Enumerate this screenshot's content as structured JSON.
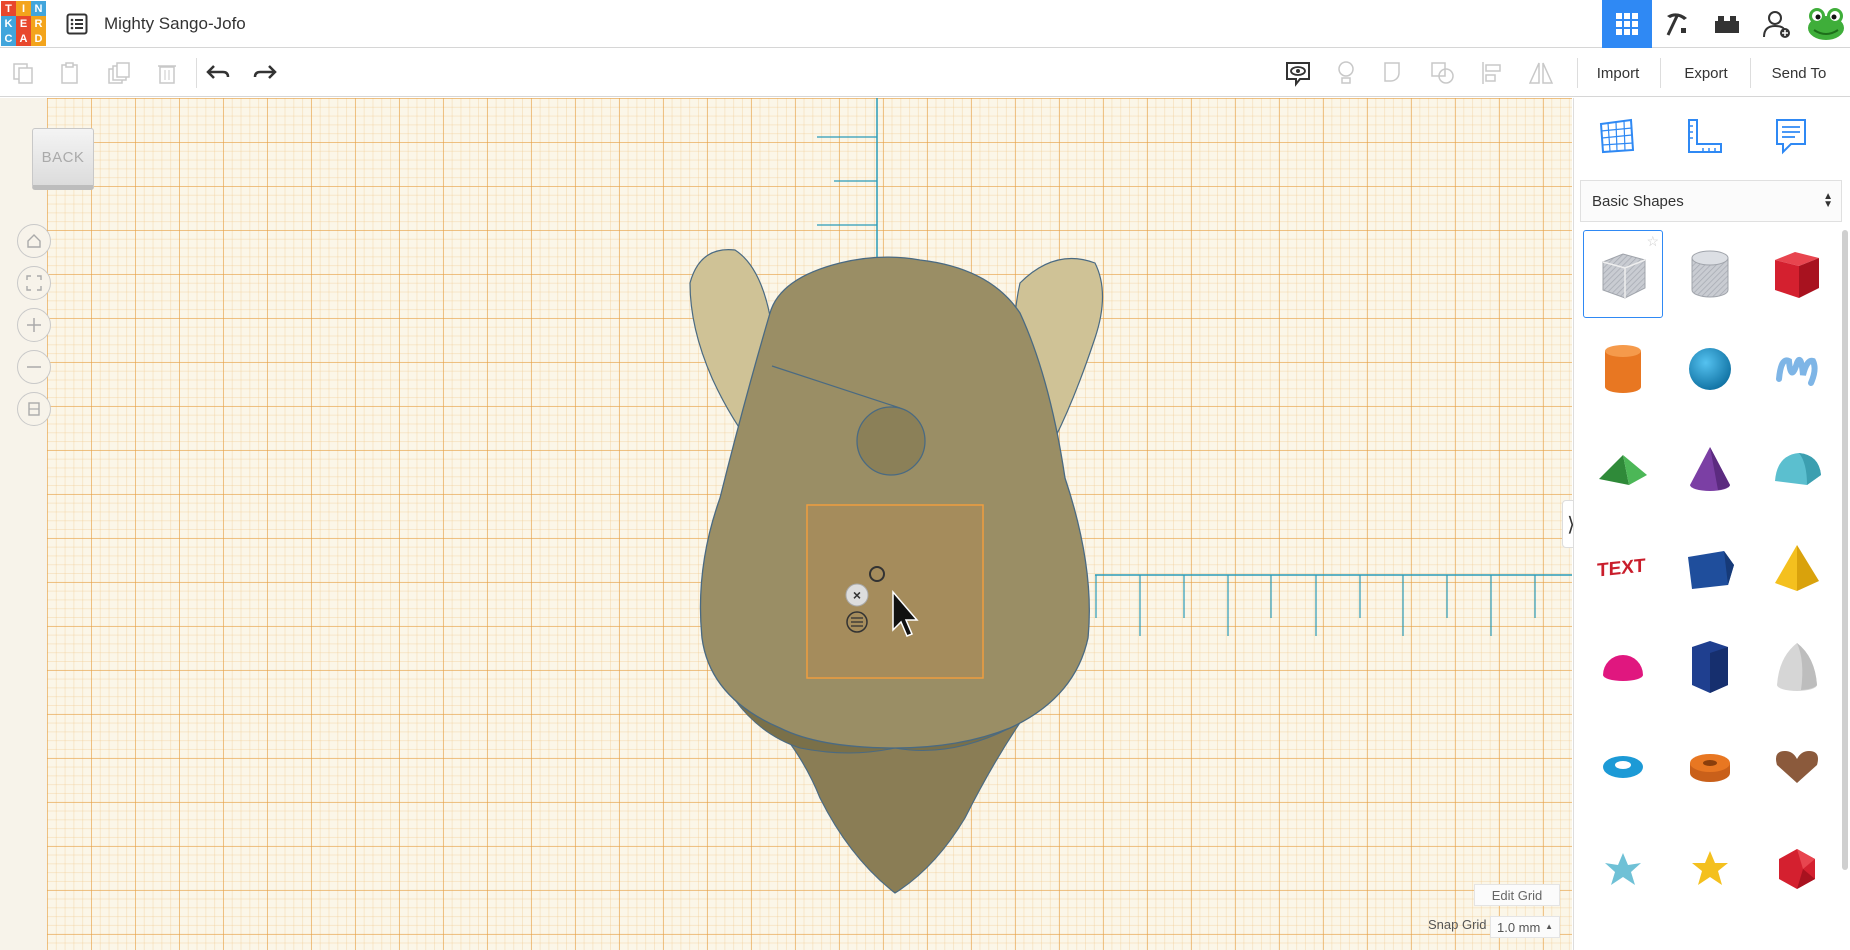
{
  "app": {
    "logo_letters": [
      "T",
      "I",
      "N",
      "K",
      "E",
      "R",
      "C",
      "A",
      "D"
    ],
    "logo_colors": [
      "#e8472c",
      "#f3a41c",
      "#41a5dc",
      "#41a5dc",
      "#e8472c",
      "#f3a41c",
      "#41a5dc",
      "#e8472c",
      "#f3a41c"
    ],
    "title": "Mighty Sango-Jofo"
  },
  "header": {
    "buttons": [
      {
        "name": "grid-view",
        "icon": "grid-icon",
        "active": true
      },
      {
        "name": "build",
        "icon": "pickaxe-icon"
      },
      {
        "name": "bricks",
        "icon": "brick-icon"
      },
      {
        "name": "add-user",
        "icon": "user-add-icon"
      },
      {
        "name": "profile",
        "icon": "avatar-icon"
      }
    ]
  },
  "toolbar": {
    "tools": [
      "copy-icon",
      "paste-icon",
      "duplicate-icon",
      "delete-icon",
      "undo-icon",
      "redo-icon"
    ],
    "view_tools": [
      "notes-visibility-icon",
      "light-icon",
      "group-icon",
      "ungroup-icon",
      "align-icon",
      "mirror-icon"
    ],
    "import_label": "Import",
    "export_label": "Export",
    "send_to_label": "Send To"
  },
  "canvas": {
    "back_label": "BACK",
    "nav": [
      "home-icon",
      "fit-icon",
      "zoom-in-icon",
      "zoom-out-icon",
      "perspective-icon"
    ],
    "edit_grid_label": "Edit Grid",
    "snap_grid_label": "Snap Grid",
    "snap_grid_value": "1.0 mm"
  },
  "sidebar": {
    "top_icons": [
      "workplane-icon",
      "ruler-icon",
      "notes-icon"
    ],
    "category": "Basic Shapes",
    "shapes": [
      {
        "name": "box-hole",
        "color": "#b8bcc4"
      },
      {
        "name": "cylinder-hole",
        "color": "#c4c8cf"
      },
      {
        "name": "box",
        "color": "#d4202f"
      },
      {
        "name": "cylinder",
        "color": "#e87722"
      },
      {
        "name": "sphere",
        "color": "#1c9ad6"
      },
      {
        "name": "scribble",
        "color": "#7eb5e6"
      },
      {
        "name": "roof",
        "color": "#3aa346"
      },
      {
        "name": "cone",
        "color": "#7b3fa4"
      },
      {
        "name": "round-roof",
        "color": "#5bbfcf"
      },
      {
        "name": "text",
        "color": "#c91d2b"
      },
      {
        "name": "wedge",
        "color": "#1f4e9c"
      },
      {
        "name": "pyramid",
        "color": "#f4c01e"
      },
      {
        "name": "half-sphere",
        "color": "#e0177f"
      },
      {
        "name": "polygon",
        "color": "#1f3f8f"
      },
      {
        "name": "paraboloid",
        "color": "#d6d6d6"
      },
      {
        "name": "torus",
        "color": "#1c9ad6"
      },
      {
        "name": "tube",
        "color": "#e87722"
      },
      {
        "name": "heart",
        "color": "#8b5a3c"
      },
      {
        "name": "star",
        "color": "#6fc1d6"
      },
      {
        "name": "star-gold",
        "color": "#f4c01e"
      },
      {
        "name": "icosahedron",
        "color": "#d4202f"
      }
    ]
  }
}
